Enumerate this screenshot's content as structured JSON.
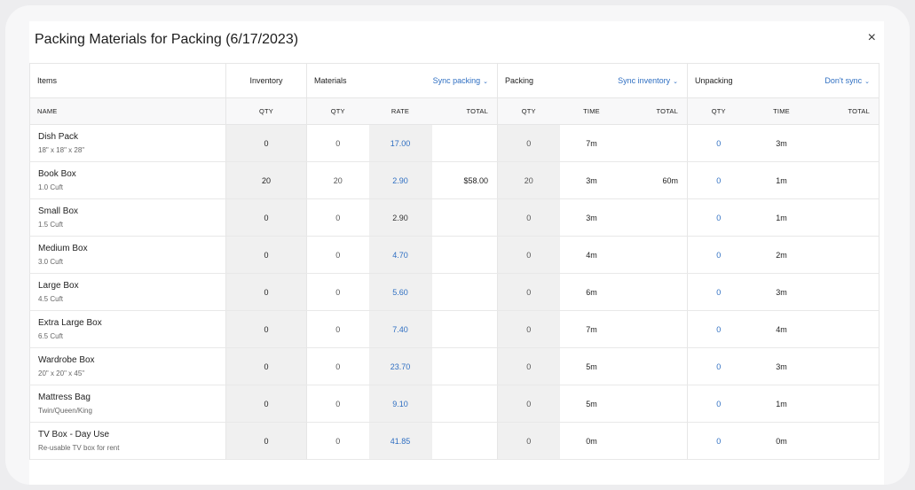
{
  "title": "Packing Materials for Packing (6/17/2023)",
  "close_icon": "×",
  "groups": {
    "items": "Items",
    "inventory": "Inventory",
    "materials": "Materials",
    "materials_sync": "Sync packing",
    "packing": "Packing",
    "packing_sync": "Sync inventory",
    "unpacking": "Unpacking",
    "unpacking_sync": "Don't sync"
  },
  "columns": {
    "name": "NAME",
    "inv_qty": "QTY",
    "mat_qty": "QTY",
    "rate": "RATE",
    "mat_total": "TOTAL",
    "pack_qty": "QTY",
    "pack_time": "TIME",
    "pack_total": "TOTAL",
    "unpack_qty": "QTY",
    "unpack_time": "TIME",
    "unpack_total": "TOTAL"
  },
  "rows": [
    {
      "name": "Dish Pack",
      "size": "18\" x 18\" x 28\"",
      "inv": "0",
      "mqty": "0",
      "rate": "17.00",
      "rate_link": true,
      "mtotal": "",
      "pqty": "0",
      "ptime": "7m",
      "ptotal": "",
      "uqty": "0",
      "utime": "3m",
      "utotal": ""
    },
    {
      "name": "Book Box",
      "size": "1.0 Cuft",
      "inv": "20",
      "mqty": "20",
      "rate": "2.90",
      "rate_link": true,
      "mtotal": "$58.00",
      "pqty": "20",
      "ptime": "3m",
      "ptotal": "60m",
      "uqty": "0",
      "utime": "1m",
      "utotal": ""
    },
    {
      "name": "Small Box",
      "size": "1.5 Cuft",
      "inv": "0",
      "mqty": "0",
      "rate": "2.90",
      "rate_link": false,
      "mtotal": "",
      "pqty": "0",
      "ptime": "3m",
      "ptotal": "",
      "uqty": "0",
      "utime": "1m",
      "utotal": ""
    },
    {
      "name": "Medium Box",
      "size": "3.0 Cuft",
      "inv": "0",
      "mqty": "0",
      "rate": "4.70",
      "rate_link": true,
      "mtotal": "",
      "pqty": "0",
      "ptime": "4m",
      "ptotal": "",
      "uqty": "0",
      "utime": "2m",
      "utotal": ""
    },
    {
      "name": "Large Box",
      "size": "4.5 Cuft",
      "inv": "0",
      "mqty": "0",
      "rate": "5.60",
      "rate_link": true,
      "mtotal": "",
      "pqty": "0",
      "ptime": "6m",
      "ptotal": "",
      "uqty": "0",
      "utime": "3m",
      "utotal": ""
    },
    {
      "name": "Extra Large Box",
      "size": "6.5 Cuft",
      "inv": "0",
      "mqty": "0",
      "rate": "7.40",
      "rate_link": true,
      "mtotal": "",
      "pqty": "0",
      "ptime": "7m",
      "ptotal": "",
      "uqty": "0",
      "utime": "4m",
      "utotal": ""
    },
    {
      "name": "Wardrobe Box",
      "size": "20\" x 20\" x 45\"",
      "inv": "0",
      "mqty": "0",
      "rate": "23.70",
      "rate_link": true,
      "mtotal": "",
      "pqty": "0",
      "ptime": "5m",
      "ptotal": "",
      "uqty": "0",
      "utime": "3m",
      "utotal": ""
    },
    {
      "name": "Mattress Bag",
      "size": "Twin/Queen/King",
      "inv": "0",
      "mqty": "0",
      "rate": "9.10",
      "rate_link": true,
      "mtotal": "",
      "pqty": "0",
      "ptime": "5m",
      "ptotal": "",
      "uqty": "0",
      "utime": "1m",
      "utotal": ""
    },
    {
      "name": "TV Box - Day Use",
      "size": "Re-usable TV box for rent",
      "inv": "0",
      "mqty": "0",
      "rate": "41.85",
      "rate_link": true,
      "mtotal": "",
      "pqty": "0",
      "ptime": "0m",
      "ptotal": "",
      "uqty": "0",
      "utime": "0m",
      "utotal": ""
    }
  ],
  "colors": {
    "link": "#2f6fc2",
    "shade": "#f0f0f0",
    "border": "#e6e6e6"
  }
}
